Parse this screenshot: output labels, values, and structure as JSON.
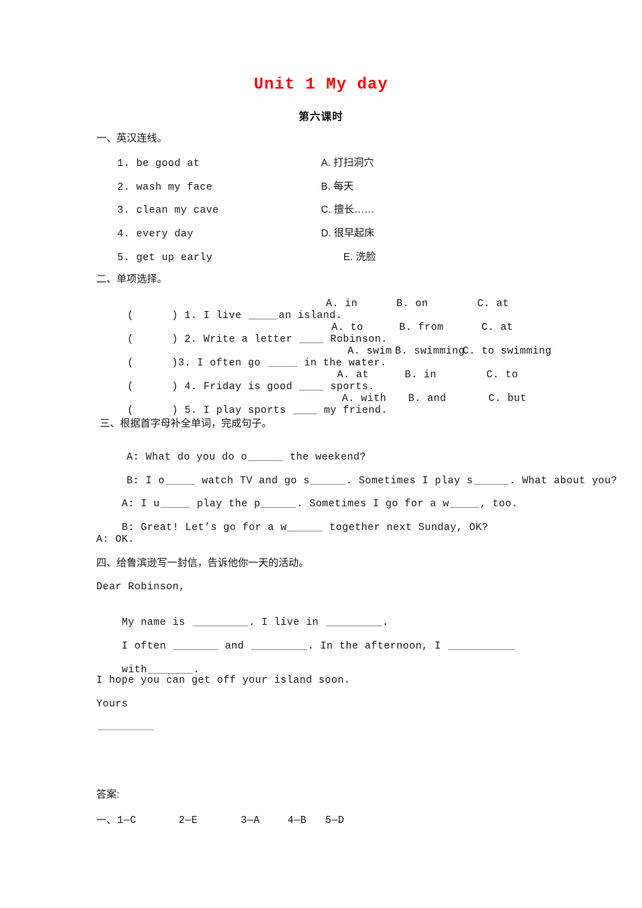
{
  "document": {
    "title": "Unit 1 My day",
    "subtitle": "第六课时",
    "title_color": "#ff0000"
  },
  "sections": {
    "one": {
      "heading": "一、英汉连线。",
      "left_items": [
        "1. be good at",
        "2. wash my face",
        "3. clean my cave",
        "4. every day",
        "5. get up early"
      ],
      "right_items": [
        "A. 打扫洞穴",
        "B. 每天",
        "C. 擅长……",
        "D. 很早起床",
        "E. 洗脸"
      ]
    },
    "two": {
      "heading": "二、单项选择。",
      "questions": [
        {
          "bracket": "(      ) 1.",
          "stem_before": " I live ",
          "stem_after": "an island.",
          "options": [
            "A. in",
            "B. on",
            "C. at"
          ]
        },
        {
          "bracket": "(      ) 2.",
          "stem_before": " Write a letter ",
          "stem_after": " Robinson.",
          "options": [
            "A. to",
            "B. from",
            "C. at"
          ]
        },
        {
          "bracket": "(      )3.",
          "stem_before": " I often go ",
          "stem_after": " in the water.",
          "options": [
            "A. swim",
            "B. swimming",
            "C. to swimming"
          ]
        },
        {
          "bracket": "(      ) 4.",
          "stem_before": " Friday is good ",
          "stem_after": " sports.",
          "options": [
            "A. at",
            "B. in",
            "C. to"
          ]
        },
        {
          "bracket": "(      ) 5.",
          "stem_before": " I play sports ",
          "stem_after": " my friend.",
          "options": [
            "A. with",
            "B. and",
            "C. but"
          ]
        }
      ]
    },
    "three": {
      "heading": "三、根据首字母补全单词，完成句子。",
      "dialog": [
        {
          "p1": "A: What do you do o",
          "p2": " the weekend?"
        },
        {
          "p1": "B: I o",
          "p2": " watch TV and go s",
          "p3": ". Sometimes I play s",
          "p4": ". What about you?"
        },
        {
          "p1": "A: I u",
          "p2": " play the p",
          "p3": ". Sometimes I go for a w",
          "p4": ", too."
        },
        {
          "p1": "B: Great! Let’s go for a w",
          "p2": " together next Sunday, OK?"
        },
        {
          "p1": "A: OK."
        }
      ]
    },
    "four": {
      "heading": "四、给鲁滨逊写一封信，告诉他你一天的活动。",
      "letter": {
        "salutation": "Dear Robinson,",
        "l1_a": "My name is ",
        "l1_b": ". I live in ",
        "l1_c": ".",
        "l2_a": "I often ",
        "l2_b": " and ",
        "l2_c": ". In the afternoon, I ",
        "l3_a": "with",
        "l3_b": ".",
        "closing_line": "I hope you can get off your island soon.",
        "sign_off": "Yours"
      }
    }
  },
  "answers": {
    "heading": "答案:",
    "row_one": {
      "label": "一、",
      "items": [
        "1—C",
        "2—E",
        "3—A",
        "4—B",
        "5—D"
      ]
    }
  }
}
